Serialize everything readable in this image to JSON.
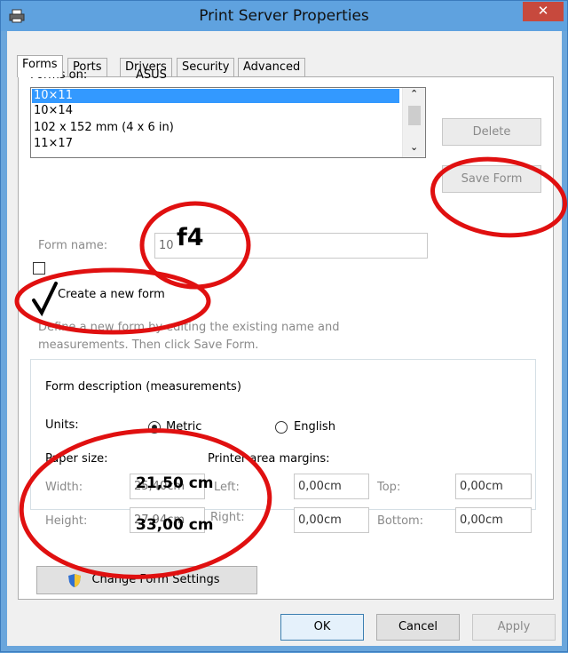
{
  "window": {
    "title": "Print Server Properties",
    "close_label": "✕"
  },
  "tabs": [
    {
      "label": "Forms",
      "active": true
    },
    {
      "label": "Ports"
    },
    {
      "label": "Drivers"
    },
    {
      "label": "Security"
    },
    {
      "label": "Advanced"
    }
  ],
  "forms_on": {
    "label": "Forms on:",
    "value": "ASUS"
  },
  "form_list": {
    "items": [
      "10×11",
      "10×14",
      "102 x 152 mm (4 x 6 in)",
      "11×17"
    ],
    "selected": "10×11"
  },
  "buttons": {
    "delete": "Delete",
    "save_form": "Save Form",
    "change_settings": "Change Form Settings",
    "ok": "OK",
    "cancel": "Cancel",
    "apply": "Apply"
  },
  "form_name": {
    "label": "Form name:",
    "value": "10"
  },
  "create_new": {
    "label": "Create a new form",
    "checked": false
  },
  "hint": {
    "line1": "Define a new form by editing the existing name and",
    "line2": "measurements. Then click Save Form."
  },
  "description": {
    "title": "Form description (measurements)",
    "units_label": "Units:",
    "metric": "Metric",
    "english": "English",
    "units_selected": "Metric",
    "paper_size": "Paper size:",
    "printer_margins": "Printer area margins:",
    "width_label": "Width:",
    "width_value": "25,40cm",
    "height_label": "Height:",
    "height_value": "27,94cm",
    "left_label": "Left:",
    "left_value": "0,00cm",
    "top_label": "Top:",
    "top_value": "0,00cm",
    "right_label": "Right:",
    "right_value": "0,00cm",
    "bottom_label": "Bottom:",
    "bottom_value": "0,00cm"
  },
  "annotations": {
    "form_name_note": "f4",
    "check_mark": "✓",
    "width_note": "21,50 cm",
    "height_note": "33,00 cm",
    "ink_color": "#e01010"
  }
}
